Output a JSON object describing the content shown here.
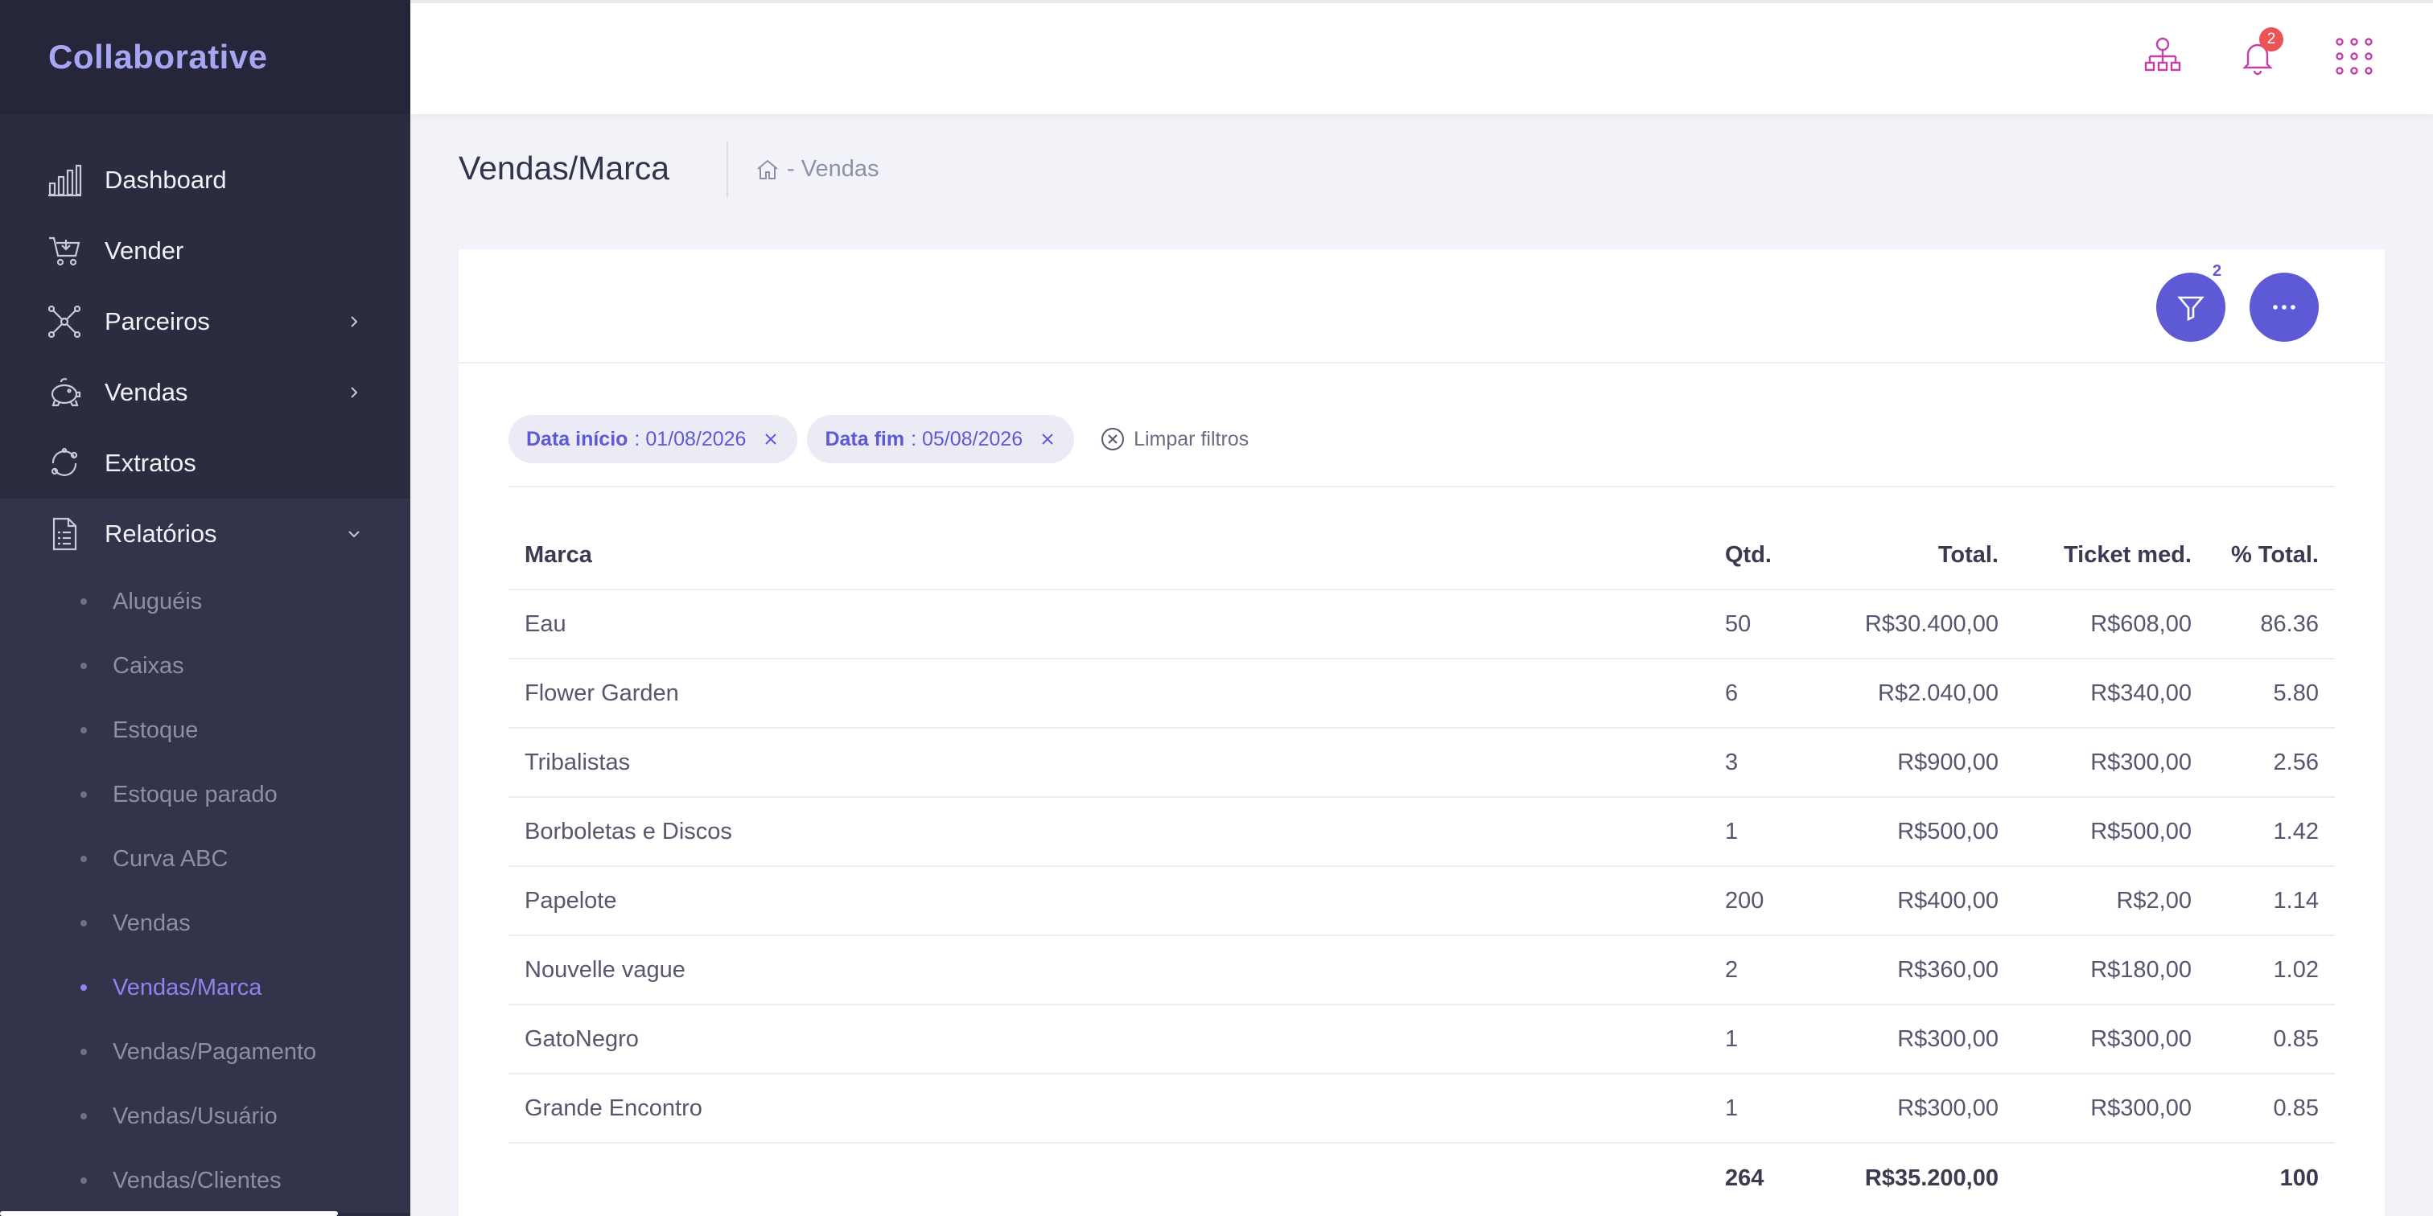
{
  "brand": "Collaborative",
  "menu": [
    {
      "label": "Dashboard",
      "icon": "bar-chart-icon",
      "chevron": ""
    },
    {
      "label": "Vender",
      "icon": "cart-icon",
      "chevron": ""
    },
    {
      "label": "Parceiros",
      "icon": "network-icon",
      "chevron": "right"
    },
    {
      "label": "Vendas",
      "icon": "piggy-bank-icon",
      "chevron": "right"
    },
    {
      "label": "Extratos",
      "icon": "cycle-icon",
      "chevron": ""
    },
    {
      "label": "Relatórios",
      "icon": "report-icon",
      "chevron": "down"
    }
  ],
  "submenu": [
    {
      "label": "Aluguéis",
      "active": false
    },
    {
      "label": "Caixas",
      "active": false
    },
    {
      "label": "Estoque",
      "active": false
    },
    {
      "label": "Estoque parado",
      "active": false
    },
    {
      "label": "Curva ABC",
      "active": false
    },
    {
      "label": "Vendas",
      "active": false
    },
    {
      "label": "Vendas/Marca",
      "active": true
    },
    {
      "label": "Vendas/Pagamento",
      "active": false
    },
    {
      "label": "Vendas/Usuário",
      "active": false
    },
    {
      "label": "Vendas/Clientes",
      "active": false
    }
  ],
  "topbar": {
    "notification_count": "2",
    "icons": [
      "org-chart-icon",
      "bell-icon",
      "apps-grid-icon"
    ]
  },
  "page": {
    "title": "Vendas/Marca",
    "breadcrumb": "- Vendas"
  },
  "card": {
    "filter_count": "2",
    "filters": [
      {
        "key": "Data início",
        "value": ": 01/08/2026"
      },
      {
        "key": "Data fim",
        "value": ": 05/08/2026"
      }
    ],
    "clear_label": "Limpar filtros"
  },
  "table": {
    "headers": {
      "marca": "Marca",
      "qtd": "Qtd.",
      "total": "Total.",
      "ticket": "Ticket med.",
      "pct": "% Total."
    },
    "rows": [
      {
        "marca": "Eau",
        "qtd": "50",
        "total": "R$30.400,00",
        "ticket": "R$608,00",
        "pct": "86.36"
      },
      {
        "marca": "Flower Garden",
        "qtd": "6",
        "total": "R$2.040,00",
        "ticket": "R$340,00",
        "pct": "5.80"
      },
      {
        "marca": "Tribalistas",
        "qtd": "3",
        "total": "R$900,00",
        "ticket": "R$300,00",
        "pct": "2.56"
      },
      {
        "marca": "Borboletas e Discos",
        "qtd": "1",
        "total": "R$500,00",
        "ticket": "R$500,00",
        "pct": "1.42"
      },
      {
        "marca": "Papelote",
        "qtd": "200",
        "total": "R$400,00",
        "ticket": "R$2,00",
        "pct": "1.14"
      },
      {
        "marca": "Nouvelle vague",
        "qtd": "2",
        "total": "R$360,00",
        "ticket": "R$180,00",
        "pct": "1.02"
      },
      {
        "marca": "GatoNegro",
        "qtd": "1",
        "total": "R$300,00",
        "ticket": "R$300,00",
        "pct": "0.85"
      },
      {
        "marca": "Grande Encontro",
        "qtd": "1",
        "total": "R$300,00",
        "ticket": "R$300,00",
        "pct": "0.85"
      }
    ],
    "footer": {
      "qtd": "264",
      "total": "R$35.200,00",
      "pct": "100"
    }
  },
  "colors": {
    "sidebar_bg": "#2b2c40",
    "accent": "#5e5ad6",
    "active_item": "#8d84ee",
    "badge": "#ea5455",
    "topbar_icon": "#c43fa8"
  }
}
